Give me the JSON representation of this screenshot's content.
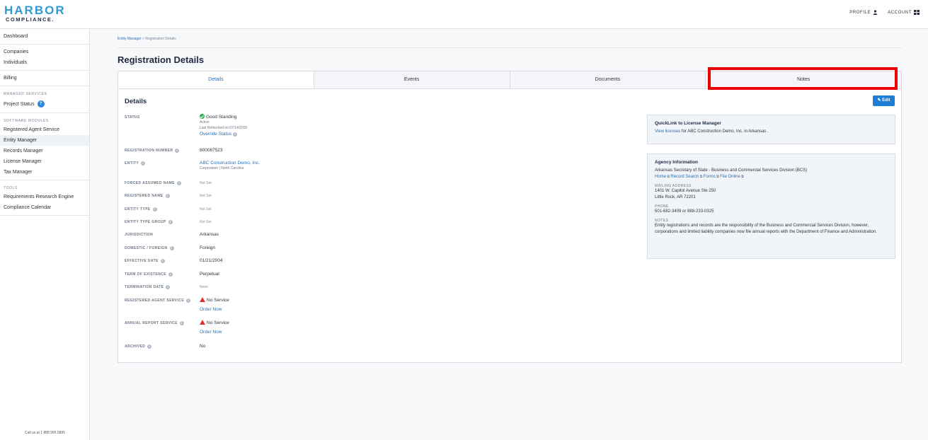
{
  "brand": {
    "line1": "HARBOR",
    "line2": "COMPLIANCE."
  },
  "topnav": {
    "profile": "PROFILE",
    "account": "ACCOUNT"
  },
  "sidebar": {
    "dashboard": "Dashboard",
    "companies": "Companies",
    "individuals": "Individuals",
    "billing": "Billing",
    "managed_head": "MANAGED SERVICES",
    "project_status": "Project Status",
    "project_badge": "?",
    "modules_head": "SOFTWARE MODULES",
    "modules": [
      "Registered Agent Service",
      "Entity Manager",
      "Records Manager",
      "License Manager",
      "Tax Manager"
    ],
    "tools_head": "TOOLS",
    "tools": [
      "Requirements Research Engine",
      "Compliance Calendar"
    ],
    "callus": "Call us at 1 888 995 5895"
  },
  "breadcrumb": {
    "parent": "Entity Manager",
    "sep": ">",
    "current": "Registration Details"
  },
  "page_title": "Registration Details",
  "tabs": [
    "Details",
    "Events",
    "Documents",
    "Notes"
  ],
  "details": {
    "title": "Details",
    "edit": "Edit",
    "status": {
      "label": "STATUS",
      "value": "Good Standing",
      "active": "Active",
      "refreshed": "Last Refreshed on 07/14/2020",
      "override": "Override Status"
    },
    "registration_number": {
      "label": "REGISTRATION NUMBER",
      "value": "800087523"
    },
    "entity": {
      "label": "ENTITY",
      "value": "ABC Construction Demo, Inc.",
      "sub": "Corporation | North Carolina"
    },
    "forced_assumed_name": {
      "label": "FORCED ASSUMED NAME",
      "value": "Not Set"
    },
    "registered_name": {
      "label": "REGISTERED NAME",
      "value": "Not Set"
    },
    "entity_type": {
      "label": "ENTITY TYPE",
      "value": "Not Set"
    },
    "entity_type_group": {
      "label": "ENTITY TYPE GROUP",
      "value": "Not Set"
    },
    "jurisdiction": {
      "label": "JURISDICTION",
      "value": "Arkansas"
    },
    "domestic_foreign": {
      "label": "DOMESTIC / FOREIGN",
      "value": "Foreign"
    },
    "effective_date": {
      "label": "EFFECTIVE DATE",
      "value": "01/21/2004"
    },
    "term_of_existence": {
      "label": "TERM OF EXISTENCE",
      "value": "Perpetual"
    },
    "termination_date": {
      "label": "TERMINATION DATE",
      "value": "None"
    },
    "registered_agent_service": {
      "label": "REGISTERED AGENT SERVICE",
      "value": "No Service",
      "link": "Order Now"
    },
    "annual_report_service": {
      "label": "ANNUAL REPORT SERVICE",
      "value": "No Service",
      "link": "Order Now"
    },
    "archived": {
      "label": "ARCHIVED",
      "value": "No"
    }
  },
  "quicklink": {
    "title": "QuickLink to License Manager",
    "link": "View licenses",
    "text": "for ABC Construction Demo, Inc. in Arkansas ."
  },
  "agency": {
    "title": "Agency Information",
    "name": "Arkansas Secretary of State - Business and Commercial Services Division (BCS)",
    "links": [
      "Home",
      "Record Search",
      "Forms",
      "File Online"
    ],
    "mailing_label": "MAILING ADDRESS",
    "address1": "1401 W. Capitol Avenue Ste 250",
    "address2": "Little Rock, AR 72201",
    "phone_label": "PHONE",
    "phone": "501-682-3409 or 888-233-0325",
    "notes_label": "NOTES",
    "notes": "Entity registrations and records are the responsibility of the Business and Commercial Services Division, however, corporations and limited liability companies now file annual reports with the Department of Finance and Administration."
  }
}
